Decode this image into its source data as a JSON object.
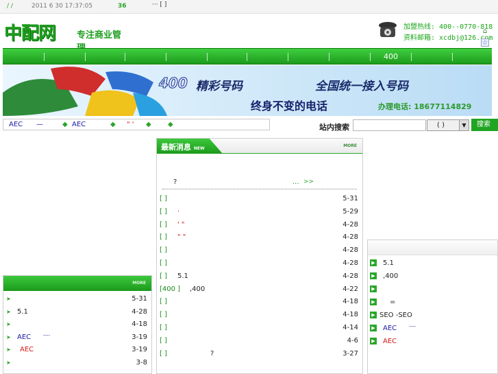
{
  "topbar": {
    "slashes": "/ /",
    "datetime": "2011 6 30  17:37:05",
    "count": "36",
    "bracket_link": "··· [ ]"
  },
  "header": {
    "logo_text": "中配网",
    "slogan": "专注商业管理",
    "hotline": "加盟热线: 400--0770-818",
    "email": "资料邮箱: xcdbj@126.com"
  },
  "nav": {
    "item_400": "400"
  },
  "banner": {
    "num": "400",
    "line1a": "精彩号码",
    "line1b": "全国统一接入号码",
    "line2": "终身不变的电话",
    "tel": "办理电话: 18677114829"
  },
  "ticker": {
    "a": "AEC",
    "dash": "—",
    "b": "AEC",
    "quote": "\" '",
    "diamond": "◆"
  },
  "search": {
    "label": "站内搜索",
    "placeholder": "",
    "select_value": "( )",
    "button": "搜索"
  },
  "news": {
    "title": "最新消息",
    "title_tag": "NEW",
    "more": "MORE",
    "headline_q": "?",
    "headline_more": "...",
    "headline_arrows": ">>",
    "rows": [
      {
        "prefix": "[ ]",
        "text": "",
        "date": "5-31"
      },
      {
        "prefix": "[ ]",
        "text": "·",
        "date": "5-29"
      },
      {
        "prefix": "[ ]",
        "text": "' \"",
        "date": "4-28"
      },
      {
        "prefix": "[ ]",
        "text": "\" \"",
        "date": "4-28"
      },
      {
        "prefix": "[ ]",
        "text": "",
        "date": "4-28"
      },
      {
        "prefix": "[ ]",
        "text": "",
        "date": "4-28"
      },
      {
        "prefix": "[ ]",
        "text": "5.1",
        "date": "4-28"
      },
      {
        "prefix": "[400 ]",
        "text": ",400",
        "date": "4-22"
      },
      {
        "prefix": "[ ]",
        "text": "",
        "date": "4-18"
      },
      {
        "prefix": "[ ]",
        "text": "",
        "date": "4-18"
      },
      {
        "prefix": "[ ]",
        "text": "",
        "date": "4-14"
      },
      {
        "prefix": "[ ]",
        "text": "",
        "date": "4-6"
      },
      {
        "prefix": "[ ]",
        "text": "?",
        "date": "3-27"
      }
    ]
  },
  "left_panel": {
    "more": "MORE",
    "rows": [
      {
        "text": "",
        "date": "5-31"
      },
      {
        "text": "5.1",
        "date": "4-28"
      },
      {
        "text": "",
        "date": "4-18"
      },
      {
        "text": "AEC",
        "extra": "----",
        "date": "3-19"
      },
      {
        "text": "AEC",
        "date": "3-19"
      },
      {
        "text": "",
        "date": "3-8"
      }
    ]
  },
  "right_panel": {
    "rows": [
      {
        "text": "5.1"
      },
      {
        "text": ",400"
      },
      {
        "text": ""
      },
      {
        "text": "="
      },
      {
        "text": "SEO    -SEO"
      },
      {
        "text": "AEC",
        "extra": "----"
      },
      {
        "text": "AEC"
      }
    ]
  },
  "colors": {
    "brand_green": "#1f9e1f",
    "link_blue": "#1a1aa8",
    "link_red": "#d01818"
  }
}
